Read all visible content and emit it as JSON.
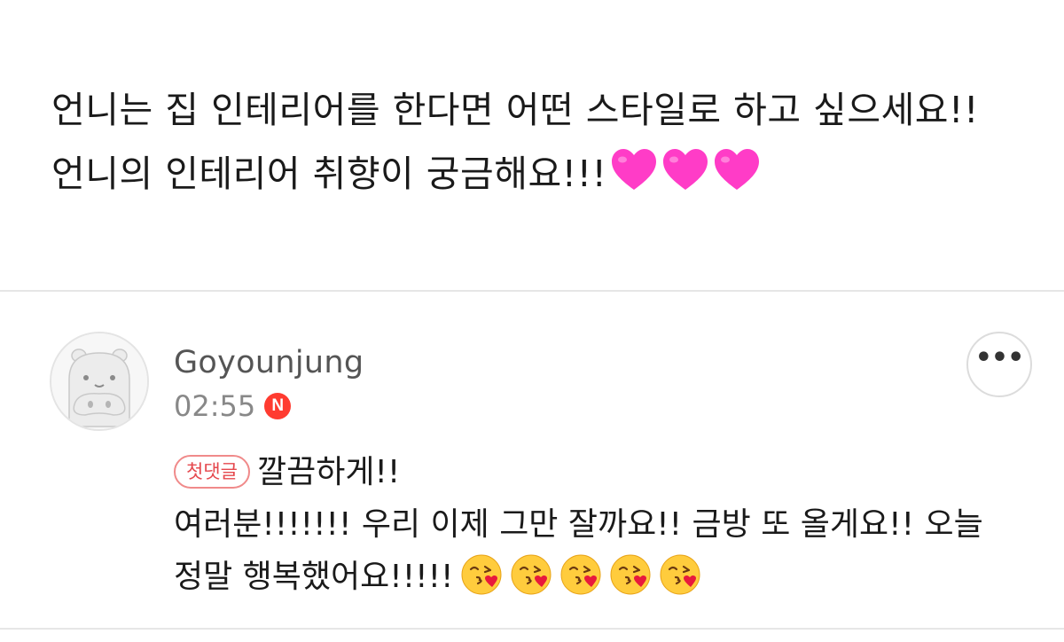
{
  "post": {
    "text": "언니는 집 인테리어를 한다면 어떤 스타일로 하고 싶으세요!! 언니의 인테리어 취향이 궁금해요!!!",
    "trailing_emoji": [
      "pink-heart",
      "pink-heart",
      "pink-heart"
    ],
    "heart_color": "#ff3cc7"
  },
  "comment": {
    "author": "Goyounjung",
    "time": "02:55",
    "new_badge": "N",
    "more_label": "•••",
    "first_comment_badge": "첫댓글",
    "line1": "깔끔하게!!",
    "line2": "여러분!!!!!!! 우리 이제 그만 잘까요!! 금방 또 올게요!! 오늘 정말 행복했어요!!!!!",
    "trailing_emoji": [
      "face-blowing-a-kiss",
      "face-blowing-a-kiss",
      "face-blowing-a-kiss",
      "face-blowing-a-kiss",
      "face-blowing-a-kiss"
    ],
    "badge_color": "#e5484d",
    "new_badge_color": "#ff3b30"
  }
}
